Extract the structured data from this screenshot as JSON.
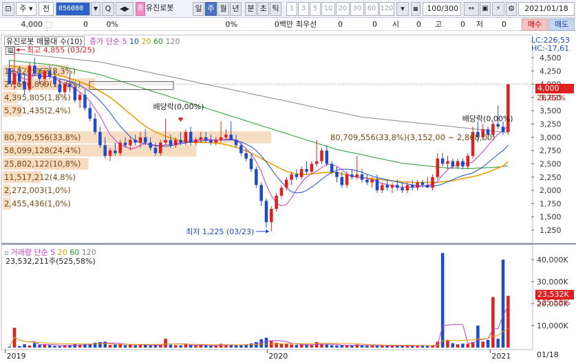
{
  "toolbar": {
    "code": "056080",
    "name": "유진로봇",
    "type": "주",
    "prev_label": "전",
    "periods": [
      "일",
      "주",
      "월",
      "년",
      "분",
      "초",
      "틱"
    ],
    "active_period": "주",
    "intervals": [
      "1",
      "3",
      "5",
      "10",
      "20",
      "30",
      "60",
      "120"
    ],
    "count": "100/300",
    "date": "2021/01/18",
    "name_badge": "종"
  },
  "info": {
    "price": "4,000",
    "zero1": "0",
    "pct1": "0%",
    "pct2": "0%",
    "amount": "0백만",
    "best_label": "최우선",
    "best1": "0",
    "best2": "0",
    "open_label": "시",
    "open": "0",
    "high_label": "고",
    "high": "0",
    "low_label": "저",
    "low": "0",
    "buy": "매수",
    "sell": "매도"
  },
  "legend_price": {
    "title": "유진로봇 매물대 수(10)",
    "ma_label": "종가 단순",
    "ma": [
      "5",
      "10",
      "20",
      "60",
      "120"
    ]
  },
  "legend_vol": {
    "title": "거래량 단순",
    "ma": [
      "5",
      "20",
      "60",
      "120"
    ],
    "current": "23,532,211주(525,58%)"
  },
  "right_panel": {
    "lc": "LC:226,53",
    "hc": "HC:-17,61",
    "price_tag": "4,000",
    "price_pct": "28,82%",
    "vol_tag": "23,532K",
    "vol_pct": "525,58%",
    "date": "01/18"
  },
  "annotations": {
    "high": "최고 4,855 (03/25)",
    "low": "최저 1,225 (03/23)",
    "div1": "배당락(0,00%)",
    "div2": "배당락(0,00%)",
    "range": "80,709,556(33,8%)(3,152,00 ~ 2,868,00)"
  },
  "colors": {
    "up": "#e02020",
    "down": "#1d4bd0",
    "ma5": "#c23ad0",
    "ma10": "#1d4bd0",
    "ma20": "#e8a000",
    "ma60": "#1f9a2e",
    "ma120": "#888888",
    "profile": "#f6dcc0"
  },
  "chart_data": {
    "type": "candlestick",
    "y_ticks": [
      "4,500",
      "4,250",
      "4,000",
      "3,750",
      "3,500",
      "3,250",
      "3,000",
      "2,750",
      "2,500",
      "2,250",
      "2,000",
      "1,750",
      "1,500",
      "1,250"
    ],
    "vol_ticks": [
      "40,000K",
      "30,000K",
      "20,000K",
      "10,000K"
    ],
    "x_ticks": [
      "2019",
      "2020",
      "2021"
    ],
    "volume_profile": [
      {
        "label": "19,824,863(8,3%)",
        "low": 4125,
        "high": 4375,
        "share": 8.3
      },
      {
        "label": "27,696,899(11,6%)",
        "low": 3875,
        "high": 4125,
        "share": 11.6
      },
      {
        "label": "4,395,805(1,8%)",
        "low": 3625,
        "high": 3875,
        "share": 1.8
      },
      {
        "label": "5,791,435(2,4%)",
        "low": 3375,
        "high": 3625,
        "share": 2.4
      },
      {
        "label": "80,709,556(33,8%)",
        "low": 2875,
        "high": 3125,
        "share": 33.8
      },
      {
        "label": "58,099,128(24,4%)",
        "low": 2625,
        "high": 2875,
        "share": 24.4
      },
      {
        "label": "25,802,122(10,8%)",
        "low": 2375,
        "high": 2625,
        "share": 10.8
      },
      {
        "label": "11,517,212(4,8%)",
        "low": 2125,
        "high": 2375,
        "share": 4.8
      },
      {
        "label": "2,272,003(1,0%)",
        "low": 1875,
        "high": 2125,
        "share": 1.0
      },
      {
        "label": "2,455,436(1,0%)",
        "low": 1625,
        "high": 1875,
        "share": 1.0
      }
    ],
    "candles": [
      [
        4300,
        4450,
        4050,
        4000
      ],
      [
        4000,
        4855,
        3900,
        4200
      ],
      [
        4200,
        4350,
        3950,
        4050
      ],
      [
        4050,
        4200,
        3800,
        3900
      ],
      [
        3900,
        4400,
        3850,
        4350
      ],
      [
        4350,
        4500,
        4150,
        4200
      ],
      [
        4200,
        4300,
        4000,
        4100
      ],
      [
        4100,
        4300,
        3950,
        4250
      ],
      [
        4250,
        4350,
        4100,
        4150
      ],
      [
        4150,
        4250,
        3950,
        4000
      ],
      [
        4000,
        4100,
        3800,
        3850
      ],
      [
        3850,
        4050,
        3750,
        4000
      ],
      [
        4000,
        4200,
        3850,
        3950
      ],
      [
        3950,
        4000,
        3650,
        3700
      ],
      [
        3700,
        3850,
        3550,
        3800
      ],
      [
        3800,
        3900,
        3500,
        3550
      ],
      [
        3550,
        3650,
        3300,
        3350
      ],
      [
        3350,
        3450,
        3050,
        3100
      ],
      [
        3100,
        3200,
        2800,
        2850
      ],
      [
        2850,
        3000,
        2600,
        2650
      ],
      [
        2650,
        2800,
        2550,
        2750
      ],
      [
        2750,
        2900,
        2650,
        2700
      ],
      [
        2700,
        2950,
        2650,
        2900
      ],
      [
        2900,
        3000,
        2800,
        2850
      ],
      [
        2850,
        3000,
        2750,
        2950
      ],
      [
        2950,
        3050,
        2850,
        2900
      ],
      [
        2900,
        3100,
        2800,
        3000
      ],
      [
        3000,
        3150,
        2850,
        2900
      ],
      [
        2900,
        3000,
        2750,
        2800
      ],
      [
        2800,
        2900,
        2650,
        2700
      ],
      [
        2700,
        2950,
        2650,
        2900
      ],
      [
        2900,
        3350,
        2850,
        2950
      ],
      [
        2950,
        3050,
        2800,
        2850
      ],
      [
        2850,
        3000,
        2800,
        2950
      ],
      [
        2950,
        3100,
        2850,
        2900
      ],
      [
        2900,
        3150,
        2850,
        3100
      ],
      [
        3100,
        3200,
        2850,
        2900
      ],
      [
        2900,
        3000,
        2850,
        2950
      ],
      [
        2950,
        3100,
        2900,
        3000
      ],
      [
        3000,
        3100,
        2900,
        2950
      ],
      [
        2950,
        3050,
        2850,
        2900
      ],
      [
        2900,
        3000,
        2850,
        2950
      ],
      [
        2950,
        3300,
        2900,
        3000
      ],
      [
        3000,
        3150,
        2950,
        3050
      ],
      [
        3050,
        3300,
        2950,
        2950
      ],
      [
        2950,
        3050,
        2800,
        2850
      ],
      [
        2850,
        2900,
        2650,
        2700
      ],
      [
        2700,
        2800,
        2550,
        2600
      ],
      [
        2600,
        2700,
        2350,
        2400
      ],
      [
        2400,
        2450,
        2050,
        2100
      ],
      [
        2100,
        2150,
        1700,
        1800
      ],
      [
        1800,
        1850,
        1300,
        1400
      ],
      [
        1400,
        1700,
        1225,
        1650
      ],
      [
        1650,
        1950,
        1600,
        1900
      ],
      [
        1900,
        2100,
        1850,
        2050
      ],
      [
        2050,
        2250,
        2000,
        2200
      ],
      [
        2200,
        2350,
        2100,
        2300
      ],
      [
        2300,
        2400,
        2200,
        2250
      ],
      [
        2250,
        2450,
        2200,
        2400
      ],
      [
        2400,
        2550,
        2300,
        2350
      ],
      [
        2350,
        2550,
        2300,
        2500
      ],
      [
        2500,
        2950,
        2450,
        2550
      ],
      [
        2550,
        2800,
        2500,
        2750
      ],
      [
        2750,
        2850,
        2450,
        2500
      ],
      [
        2500,
        2550,
        2300,
        2350
      ],
      [
        2350,
        2450,
        2150,
        2250
      ],
      [
        2250,
        2350,
        2050,
        2100
      ],
      [
        2100,
        2350,
        2050,
        2300
      ],
      [
        2300,
        2400,
        2200,
        2250
      ],
      [
        2250,
        2650,
        2200,
        2300
      ],
      [
        2300,
        2400,
        2150,
        2200
      ],
      [
        2200,
        2300,
        2100,
        2150
      ],
      [
        2150,
        2250,
        2050,
        2200
      ],
      [
        2200,
        2300,
        1950,
        2000
      ],
      [
        2000,
        2150,
        1950,
        2100
      ],
      [
        2100,
        2200,
        2000,
        2050
      ],
      [
        2050,
        2150,
        1950,
        2100
      ],
      [
        2100,
        2200,
        2000,
        2050
      ],
      [
        2050,
        2150,
        1950,
        2000
      ],
      [
        2000,
        2150,
        1950,
        2100
      ],
      [
        2100,
        2200,
        2000,
        2050
      ],
      [
        2050,
        2200,
        2000,
        2150
      ],
      [
        2150,
        2200,
        2050,
        2100
      ],
      [
        2100,
        2250,
        2050,
        2050
      ],
      [
        2050,
        2300,
        2000,
        2250
      ],
      [
        2250,
        2700,
        2200,
        2600
      ],
      [
        2600,
        2700,
        2450,
        2500
      ],
      [
        2500,
        2650,
        2400,
        2550
      ],
      [
        2550,
        2600,
        2400,
        2450
      ],
      [
        2450,
        2600,
        2400,
        2550
      ],
      [
        2550,
        2600,
        2400,
        2450
      ],
      [
        2450,
        2700,
        2400,
        2650
      ],
      [
        2650,
        3200,
        2600,
        3100
      ],
      [
        3100,
        3300,
        2900,
        3000
      ],
      [
        3000,
        3250,
        2950,
        3150
      ],
      [
        3150,
        3200,
        2950,
        3050
      ],
      [
        3050,
        3300,
        3000,
        3250
      ],
      [
        3250,
        3600,
        3150,
        3200
      ],
      [
        3200,
        3300,
        3050,
        3100
      ],
      [
        3100,
        4000,
        3050,
        4000
      ]
    ],
    "volume": [
      400,
      9000,
      700,
      1500,
      900,
      2100,
      1200,
      1400,
      1100,
      800,
      700,
      1000,
      1200,
      1800,
      1300,
      1500,
      1700,
      2200,
      2500,
      2700,
      1200,
      1400,
      1600,
      1100,
      1300,
      1000,
      1500,
      1200,
      900,
      1000,
      1100,
      4000,
      1300,
      1100,
      1000,
      1400,
      1200,
      900,
      1000,
      900,
      900,
      1000,
      1700,
      1100,
      1200,
      1000,
      1300,
      1500,
      1900,
      2500,
      3800,
      4500,
      3000,
      2200,
      1800,
      1600,
      1400,
      1200,
      1300,
      1200,
      1100,
      2500,
      1600,
      1300,
      1100,
      1000,
      1000,
      1000,
      900,
      1400,
      900,
      800,
      900,
      1000,
      900,
      800,
      800,
      900,
      800,
      900,
      1000,
      900,
      900,
      800,
      1100,
      2700,
      43000,
      3500,
      2000,
      1500,
      1800,
      1700,
      2500,
      10000,
      2700,
      3500,
      23000,
      4000,
      40000,
      23532
    ],
    "ma5": [
      4200,
      4210,
      4150,
      4100,
      4090,
      4180,
      4150,
      4140,
      4160,
      4110,
      4060,
      4000,
      3970,
      3920,
      3850,
      3780,
      3680,
      3540,
      3400,
      3220,
      3050,
      2950,
      2850,
      2830,
      2780,
      2800,
      2850,
      2880,
      2870,
      2850,
      2840,
      2860,
      2870,
      2880,
      2900,
      2920,
      2940,
      2950,
      2960,
      2960,
      2950,
      2940,
      2950,
      2960,
      2970,
      2950,
      2870,
      2780,
      2690,
      2540,
      2350,
      2100,
      1900,
      1760,
      1710,
      1730,
      1860,
      2010,
      2150,
      2250,
      2310,
      2360,
      2430,
      2490,
      2490,
      2450,
      2390,
      2310,
      2260,
      2250,
      2240,
      2220,
      2200,
      2170,
      2130,
      2110,
      2090,
      2070,
      2060,
      2060,
      2060,
      2070,
      2080,
      2100,
      2110,
      2170,
      2290,
      2390,
      2450,
      2480,
      2510,
      2500,
      2540,
      2630,
      2730,
      2840,
      2960,
      3060,
      3120,
      3220
    ],
    "ma10": [
      4250,
      4250,
      4200,
      4180,
      4170,
      4170,
      4160,
      4150,
      4140,
      4130,
      4100,
      4080,
      4050,
      4020,
      3980,
      3920,
      3860,
      3780,
      3690,
      3580,
      3460,
      3330,
      3210,
      3110,
      3010,
      2940,
      2900,
      2880,
      2860,
      2840,
      2830,
      2830,
      2840,
      2860,
      2880,
      2890,
      2910,
      2920,
      2930,
      2940,
      2950,
      2950,
      2950,
      2950,
      2950,
      2940,
      2910,
      2870,
      2820,
      2750,
      2650,
      2530,
      2400,
      2270,
      2160,
      2050,
      1970,
      1950,
      1960,
      2000,
      2060,
      2130,
      2210,
      2280,
      2340,
      2380,
      2400,
      2400,
      2390,
      2370,
      2340,
      2300,
      2270,
      2240,
      2220,
      2200,
      2180,
      2160,
      2140,
      2120,
      2100,
      2090,
      2080,
      2080,
      2080,
      2090,
      2120,
      2160,
      2200,
      2240,
      2280,
      2300,
      2330,
      2380,
      2440,
      2520,
      2600,
      2680,
      2750,
      2850
    ],
    "ma20": [
      4350,
      4340,
      4320,
      4300,
      4280,
      4260,
      4240,
      4220,
      4200,
      4180,
      4160,
      4140,
      4110,
      4080,
      4050,
      4010,
      3970,
      3920,
      3870,
      3810,
      3750,
      3680,
      3600,
      3520,
      3440,
      3360,
      3280,
      3210,
      3150,
      3100,
      3060,
      3020,
      2990,
      2960,
      2940,
      2920,
      2910,
      2900,
      2900,
      2900,
      2900,
      2890,
      2880,
      2860,
      2840,
      2810,
      2780,
      2740,
      2700,
      2650,
      2600,
      2550,
      2500,
      2450,
      2400,
      2360,
      2330,
      2310,
      2300,
      2300,
      2310,
      2320,
      2330,
      2340,
      2340,
      2330,
      2310,
      2290,
      2270,
      2250,
      2240,
      2230,
      2220,
      2210,
      2200,
      2190,
      2180,
      2170,
      2160,
      2160,
      2150,
      2150,
      2150,
      2150,
      2150,
      2150,
      2160,
      2170,
      2180,
      2200,
      2220,
      2240,
      2260,
      2280,
      2310,
      2340,
      2380,
      2420,
      2460,
      2540
    ],
    "ma60": [
      4450,
      4440,
      4430,
      4420,
      4410,
      4400,
      4390,
      4380,
      4370,
      4360,
      4340,
      4320,
      4300,
      4280,
      4260,
      4240,
      4220,
      4200,
      4180,
      4150,
      4120,
      4090,
      4060,
      4030,
      4000,
      3970,
      3940,
      3910,
      3880,
      3850,
      3820,
      3790,
      3760,
      3730,
      3700,
      3670,
      3640,
      3610,
      3580,
      3550,
      3520,
      3490,
      3460,
      3430,
      3400,
      3370,
      3340,
      3310,
      3280,
      3250,
      3220,
      3190,
      3160,
      3130,
      3100,
      3070,
      3040,
      3010,
      2980,
      2950,
      2920,
      2890,
      2860,
      2830,
      2800,
      2770,
      2750,
      2730,
      2710,
      2690,
      2670,
      2650,
      2630,
      2610,
      2590,
      2570,
      2550,
      2530,
      2510,
      2500,
      2490,
      2480,
      2470,
      2460,
      2450,
      2440,
      2430,
      2420,
      2420,
      2420,
      2410,
      2410,
      2410,
      2420,
      2420,
      2430,
      2430,
      2440,
      2450,
      2460
    ],
    "ma120": [
      4600,
      4590,
      4580,
      4570,
      4560,
      4550,
      4540,
      4530,
      4520,
      4510,
      4500,
      4490,
      4480,
      4470,
      4460,
      4450,
      4440,
      4430,
      4420,
      4400,
      4380,
      4360,
      4340,
      4320,
      4300,
      4280,
      4260,
      4240,
      4220,
      4200,
      4180,
      4160,
      4140,
      4120,
      4100,
      4080,
      4060,
      4040,
      4020,
      4000,
      3980,
      3960,
      3940,
      3920,
      3900,
      3880,
      3860,
      3840,
      3820,
      3800,
      3780,
      3760,
      3740,
      3720,
      3700,
      3680,
      3660,
      3640,
      3620,
      3600,
      3580,
      3560,
      3540,
      3520,
      3500,
      3480,
      3460,
      3440,
      3420,
      3400,
      3380,
      3370,
      3360,
      3350,
      3340,
      3330,
      3320,
      3310,
      3300,
      3290,
      3280,
      3270,
      3260,
      3250,
      3240,
      3230,
      3220,
      3210,
      3200,
      3190,
      3180,
      3170,
      3160,
      3150,
      3140,
      3130,
      3120,
      3110,
      3100,
      3090
    ]
  }
}
